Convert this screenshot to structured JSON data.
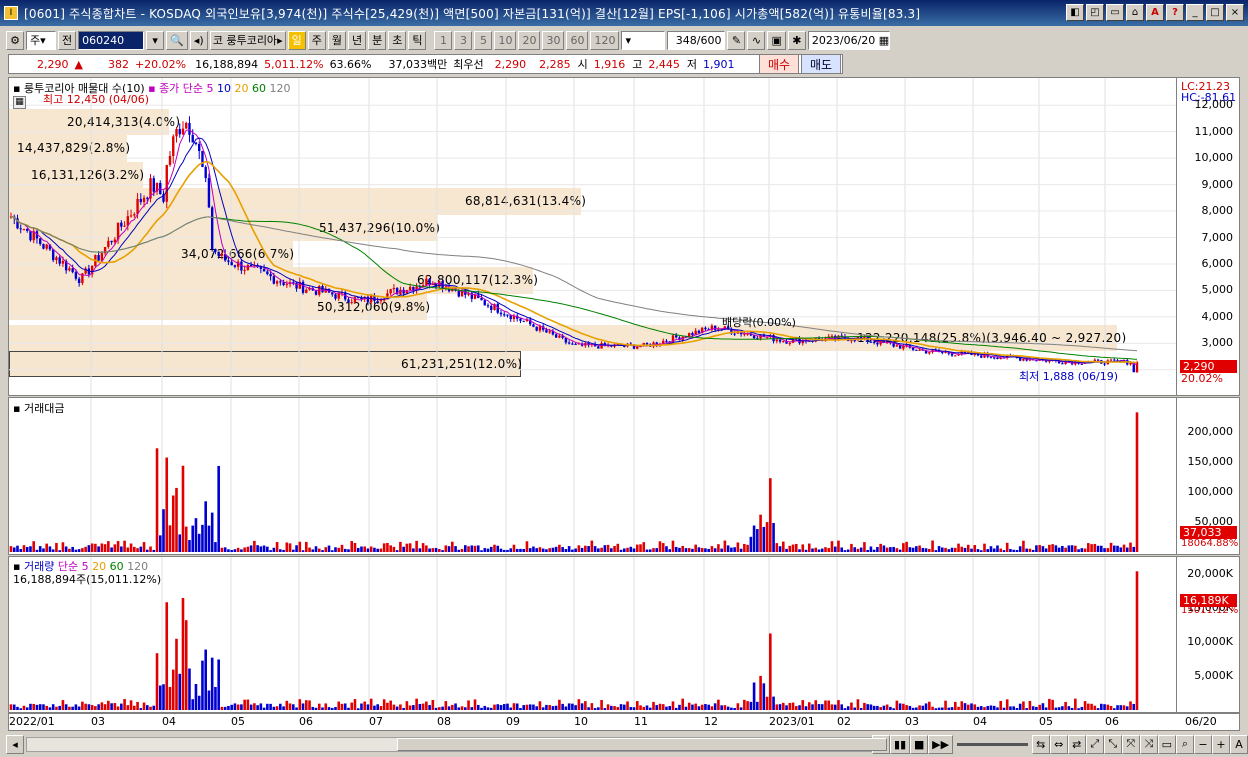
{
  "window": {
    "title": "[0601] 주식종합차트 - KOSDAQ 외국인보유[3,974(천)] 주식수[25,429(천)] 액면[500] 자본금[131(억)] 결산[12월] EPS[-1,106] 시가총액[582(억)] 유통비율[83.3]",
    "buttons": [
      "◧",
      "◰",
      "▭",
      "⌂",
      "A",
      "?",
      "_",
      "□",
      "×"
    ]
  },
  "toolbar": {
    "market": "주",
    "total": "전",
    "code": "060240",
    "stock_name": "룽투코리아",
    "periods": [
      "일",
      "주",
      "월",
      "년",
      "분",
      "초",
      "틱"
    ],
    "active_period": "일",
    "minute_units": [
      "1",
      "3",
      "5",
      "10",
      "20",
      "30",
      "60",
      "120"
    ],
    "count": "348",
    "count_max": "/600",
    "date": "2023/06/20"
  },
  "quote": {
    "price": "2,290",
    "arrow": "▲",
    "change": "382",
    "change_pct": "+20.02%",
    "volume": "16,188,894",
    "vol_ratio": "5,011.12%",
    "turnover": "63.66%",
    "amount": "37,033백만",
    "best_label": "최우선",
    "best_ask": "2,290",
    "best_bid": "2,285",
    "open_label": "시",
    "open": "1,916",
    "high_label": "고",
    "high": "2,445",
    "low_label": "저",
    "low": "1,901",
    "buy_label": "매수",
    "sell_label": "매도"
  },
  "price_panel": {
    "legend_name": "룽투코리아 매물대 수(10)",
    "legend_ma": "종가 단순",
    "ma_periods": [
      "5",
      "10",
      "20",
      "60",
      "120"
    ],
    "high_note": "최고 12,450 (04/06)",
    "low_note": "최저 1,888 (06/19)",
    "dividend_note": "배당락(0.00%)",
    "lc": "LC:21.23",
    "hc": "HC:-81.61",
    "last_price_tag": "2,290",
    "last_pct_tag": "20.02%",
    "y_ticks": [
      "12,000",
      "11,000",
      "10,000",
      "9,000",
      "8,000",
      "7,000",
      "6,000",
      "5,000",
      "4,000",
      "3,000",
      "2,000"
    ],
    "volume_profile": [
      {
        "label": "20,414,313(4.0%)"
      },
      {
        "label": "14,437,829(2.8%)"
      },
      {
        "label": "16,131,126(3.2%)"
      },
      {
        "label": "68,814,631(13.4%)"
      },
      {
        "label": "51,437,296(10.0%)"
      },
      {
        "label": "34,072,666(6.7%)"
      },
      {
        "label": "62,800,117(12.3%)"
      },
      {
        "label": "50,312,060(9.8%)"
      },
      {
        "label": "132,220,148(25.8%)(3,946.40 ~ 2,927.20)"
      },
      {
        "label": "61,231,251(12.0%)"
      }
    ]
  },
  "amount_panel": {
    "title": "거래대금",
    "y_ticks": [
      "200,000",
      "150,000",
      "100,000",
      "50,000"
    ],
    "last_tag": "37,033",
    "ratio_tag": "18064.88%"
  },
  "volume_panel": {
    "title": "거래량",
    "legend_ma": "단순",
    "ma_periods": [
      "5",
      "20",
      "60",
      "120"
    ],
    "sub": "16,188,894주(15,011.12%)",
    "y_ticks": [
      "20,000K",
      "15,000K",
      "10,000K",
      "5,000K"
    ],
    "last_tag": "16,189K",
    "ratio_tag": "15011.12%"
  },
  "x_axis": {
    "labels": [
      "2022/01",
      "03",
      "04",
      "05",
      "06",
      "07",
      "08",
      "09",
      "10",
      "11",
      "12",
      "2023/01",
      "02",
      "03",
      "04",
      "05",
      "06",
      "06/20"
    ]
  },
  "colors": {
    "up": "#e00000",
    "down": "#0000d0",
    "ma5": "#c000c0",
    "ma10": "#0000c0",
    "ma20": "#e8a000",
    "ma60": "#008000",
    "ma120": "#808080",
    "profile": "#f6e4cc"
  },
  "chart_data": {
    "type": "candlestick",
    "x": [
      "2022/01",
      "03",
      "04",
      "05",
      "06",
      "07",
      "08",
      "09",
      "10",
      "11",
      "12",
      "2023/01",
      "02",
      "03",
      "04",
      "05",
      "06"
    ],
    "close": [
      7800,
      5400,
      9000,
      6200,
      5200,
      4600,
      5400,
      4200,
      2900,
      2900,
      3600,
      3100,
      3200,
      2700,
      2500,
      2300,
      2290
    ],
    "ylim": [
      1500,
      12500
    ]
  }
}
